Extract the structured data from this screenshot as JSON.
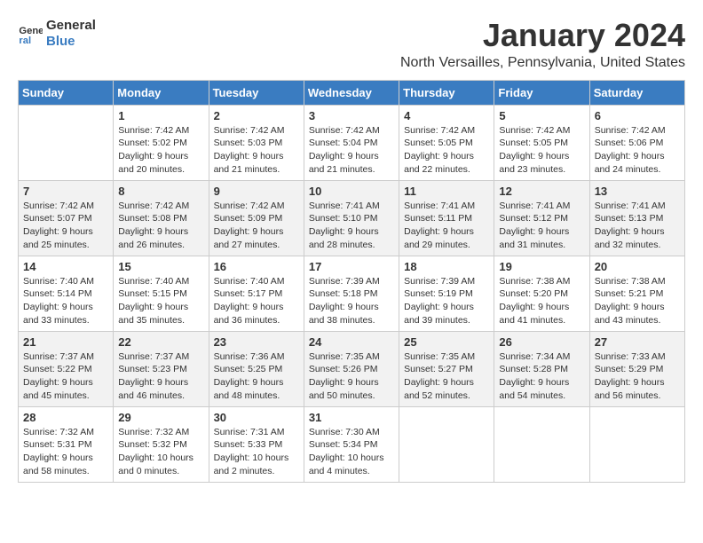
{
  "header": {
    "logo_general": "General",
    "logo_blue": "Blue",
    "title": "January 2024",
    "location": "North Versailles, Pennsylvania, United States"
  },
  "calendar": {
    "columns": [
      "Sunday",
      "Monday",
      "Tuesday",
      "Wednesday",
      "Thursday",
      "Friday",
      "Saturday"
    ],
    "weeks": [
      [
        {
          "day": "",
          "info": ""
        },
        {
          "day": "1",
          "info": "Sunrise: 7:42 AM\nSunset: 5:02 PM\nDaylight: 9 hours\nand 20 minutes."
        },
        {
          "day": "2",
          "info": "Sunrise: 7:42 AM\nSunset: 5:03 PM\nDaylight: 9 hours\nand 21 minutes."
        },
        {
          "day": "3",
          "info": "Sunrise: 7:42 AM\nSunset: 5:04 PM\nDaylight: 9 hours\nand 21 minutes."
        },
        {
          "day": "4",
          "info": "Sunrise: 7:42 AM\nSunset: 5:05 PM\nDaylight: 9 hours\nand 22 minutes."
        },
        {
          "day": "5",
          "info": "Sunrise: 7:42 AM\nSunset: 5:05 PM\nDaylight: 9 hours\nand 23 minutes."
        },
        {
          "day": "6",
          "info": "Sunrise: 7:42 AM\nSunset: 5:06 PM\nDaylight: 9 hours\nand 24 minutes."
        }
      ],
      [
        {
          "day": "7",
          "info": "Sunrise: 7:42 AM\nSunset: 5:07 PM\nDaylight: 9 hours\nand 25 minutes."
        },
        {
          "day": "8",
          "info": "Sunrise: 7:42 AM\nSunset: 5:08 PM\nDaylight: 9 hours\nand 26 minutes."
        },
        {
          "day": "9",
          "info": "Sunrise: 7:42 AM\nSunset: 5:09 PM\nDaylight: 9 hours\nand 27 minutes."
        },
        {
          "day": "10",
          "info": "Sunrise: 7:41 AM\nSunset: 5:10 PM\nDaylight: 9 hours\nand 28 minutes."
        },
        {
          "day": "11",
          "info": "Sunrise: 7:41 AM\nSunset: 5:11 PM\nDaylight: 9 hours\nand 29 minutes."
        },
        {
          "day": "12",
          "info": "Sunrise: 7:41 AM\nSunset: 5:12 PM\nDaylight: 9 hours\nand 31 minutes."
        },
        {
          "day": "13",
          "info": "Sunrise: 7:41 AM\nSunset: 5:13 PM\nDaylight: 9 hours\nand 32 minutes."
        }
      ],
      [
        {
          "day": "14",
          "info": "Sunrise: 7:40 AM\nSunset: 5:14 PM\nDaylight: 9 hours\nand 33 minutes."
        },
        {
          "day": "15",
          "info": "Sunrise: 7:40 AM\nSunset: 5:15 PM\nDaylight: 9 hours\nand 35 minutes."
        },
        {
          "day": "16",
          "info": "Sunrise: 7:40 AM\nSunset: 5:17 PM\nDaylight: 9 hours\nand 36 minutes."
        },
        {
          "day": "17",
          "info": "Sunrise: 7:39 AM\nSunset: 5:18 PM\nDaylight: 9 hours\nand 38 minutes."
        },
        {
          "day": "18",
          "info": "Sunrise: 7:39 AM\nSunset: 5:19 PM\nDaylight: 9 hours\nand 39 minutes."
        },
        {
          "day": "19",
          "info": "Sunrise: 7:38 AM\nSunset: 5:20 PM\nDaylight: 9 hours\nand 41 minutes."
        },
        {
          "day": "20",
          "info": "Sunrise: 7:38 AM\nSunset: 5:21 PM\nDaylight: 9 hours\nand 43 minutes."
        }
      ],
      [
        {
          "day": "21",
          "info": "Sunrise: 7:37 AM\nSunset: 5:22 PM\nDaylight: 9 hours\nand 45 minutes."
        },
        {
          "day": "22",
          "info": "Sunrise: 7:37 AM\nSunset: 5:23 PM\nDaylight: 9 hours\nand 46 minutes."
        },
        {
          "day": "23",
          "info": "Sunrise: 7:36 AM\nSunset: 5:25 PM\nDaylight: 9 hours\nand 48 minutes."
        },
        {
          "day": "24",
          "info": "Sunrise: 7:35 AM\nSunset: 5:26 PM\nDaylight: 9 hours\nand 50 minutes."
        },
        {
          "day": "25",
          "info": "Sunrise: 7:35 AM\nSunset: 5:27 PM\nDaylight: 9 hours\nand 52 minutes."
        },
        {
          "day": "26",
          "info": "Sunrise: 7:34 AM\nSunset: 5:28 PM\nDaylight: 9 hours\nand 54 minutes."
        },
        {
          "day": "27",
          "info": "Sunrise: 7:33 AM\nSunset: 5:29 PM\nDaylight: 9 hours\nand 56 minutes."
        }
      ],
      [
        {
          "day": "28",
          "info": "Sunrise: 7:32 AM\nSunset: 5:31 PM\nDaylight: 9 hours\nand 58 minutes."
        },
        {
          "day": "29",
          "info": "Sunrise: 7:32 AM\nSunset: 5:32 PM\nDaylight: 10 hours\nand 0 minutes."
        },
        {
          "day": "30",
          "info": "Sunrise: 7:31 AM\nSunset: 5:33 PM\nDaylight: 10 hours\nand 2 minutes."
        },
        {
          "day": "31",
          "info": "Sunrise: 7:30 AM\nSunset: 5:34 PM\nDaylight: 10 hours\nand 4 minutes."
        },
        {
          "day": "",
          "info": ""
        },
        {
          "day": "",
          "info": ""
        },
        {
          "day": "",
          "info": ""
        }
      ]
    ]
  }
}
